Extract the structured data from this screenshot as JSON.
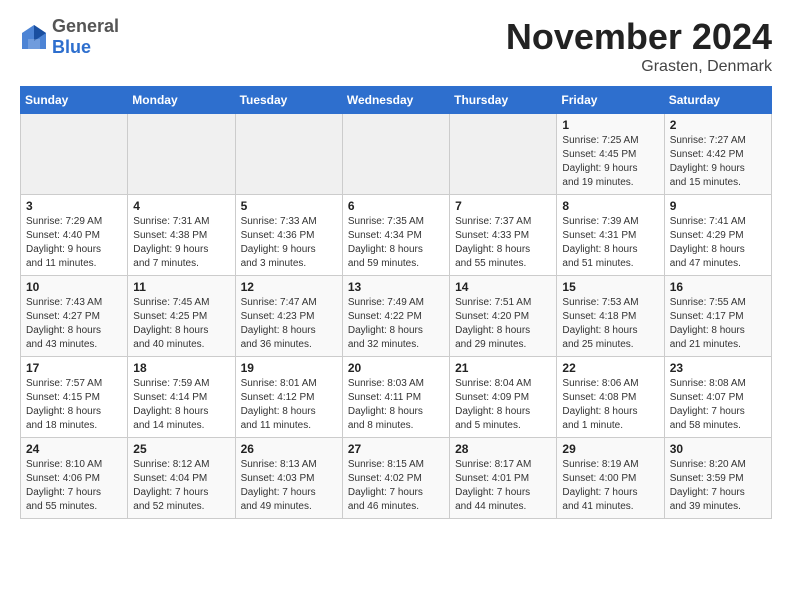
{
  "header": {
    "logo_general": "General",
    "logo_blue": "Blue",
    "title": "November 2024",
    "location": "Grasten, Denmark"
  },
  "weekdays": [
    "Sunday",
    "Monday",
    "Tuesday",
    "Wednesday",
    "Thursday",
    "Friday",
    "Saturday"
  ],
  "weeks": [
    [
      {
        "day": "",
        "info": ""
      },
      {
        "day": "",
        "info": ""
      },
      {
        "day": "",
        "info": ""
      },
      {
        "day": "",
        "info": ""
      },
      {
        "day": "",
        "info": ""
      },
      {
        "day": "1",
        "info": "Sunrise: 7:25 AM\nSunset: 4:45 PM\nDaylight: 9 hours\nand 19 minutes."
      },
      {
        "day": "2",
        "info": "Sunrise: 7:27 AM\nSunset: 4:42 PM\nDaylight: 9 hours\nand 15 minutes."
      }
    ],
    [
      {
        "day": "3",
        "info": "Sunrise: 7:29 AM\nSunset: 4:40 PM\nDaylight: 9 hours\nand 11 minutes."
      },
      {
        "day": "4",
        "info": "Sunrise: 7:31 AM\nSunset: 4:38 PM\nDaylight: 9 hours\nand 7 minutes."
      },
      {
        "day": "5",
        "info": "Sunrise: 7:33 AM\nSunset: 4:36 PM\nDaylight: 9 hours\nand 3 minutes."
      },
      {
        "day": "6",
        "info": "Sunrise: 7:35 AM\nSunset: 4:34 PM\nDaylight: 8 hours\nand 59 minutes."
      },
      {
        "day": "7",
        "info": "Sunrise: 7:37 AM\nSunset: 4:33 PM\nDaylight: 8 hours\nand 55 minutes."
      },
      {
        "day": "8",
        "info": "Sunrise: 7:39 AM\nSunset: 4:31 PM\nDaylight: 8 hours\nand 51 minutes."
      },
      {
        "day": "9",
        "info": "Sunrise: 7:41 AM\nSunset: 4:29 PM\nDaylight: 8 hours\nand 47 minutes."
      }
    ],
    [
      {
        "day": "10",
        "info": "Sunrise: 7:43 AM\nSunset: 4:27 PM\nDaylight: 8 hours\nand 43 minutes."
      },
      {
        "day": "11",
        "info": "Sunrise: 7:45 AM\nSunset: 4:25 PM\nDaylight: 8 hours\nand 40 minutes."
      },
      {
        "day": "12",
        "info": "Sunrise: 7:47 AM\nSunset: 4:23 PM\nDaylight: 8 hours\nand 36 minutes."
      },
      {
        "day": "13",
        "info": "Sunrise: 7:49 AM\nSunset: 4:22 PM\nDaylight: 8 hours\nand 32 minutes."
      },
      {
        "day": "14",
        "info": "Sunrise: 7:51 AM\nSunset: 4:20 PM\nDaylight: 8 hours\nand 29 minutes."
      },
      {
        "day": "15",
        "info": "Sunrise: 7:53 AM\nSunset: 4:18 PM\nDaylight: 8 hours\nand 25 minutes."
      },
      {
        "day": "16",
        "info": "Sunrise: 7:55 AM\nSunset: 4:17 PM\nDaylight: 8 hours\nand 21 minutes."
      }
    ],
    [
      {
        "day": "17",
        "info": "Sunrise: 7:57 AM\nSunset: 4:15 PM\nDaylight: 8 hours\nand 18 minutes."
      },
      {
        "day": "18",
        "info": "Sunrise: 7:59 AM\nSunset: 4:14 PM\nDaylight: 8 hours\nand 14 minutes."
      },
      {
        "day": "19",
        "info": "Sunrise: 8:01 AM\nSunset: 4:12 PM\nDaylight: 8 hours\nand 11 minutes."
      },
      {
        "day": "20",
        "info": "Sunrise: 8:03 AM\nSunset: 4:11 PM\nDaylight: 8 hours\nand 8 minutes."
      },
      {
        "day": "21",
        "info": "Sunrise: 8:04 AM\nSunset: 4:09 PM\nDaylight: 8 hours\nand 5 minutes."
      },
      {
        "day": "22",
        "info": "Sunrise: 8:06 AM\nSunset: 4:08 PM\nDaylight: 8 hours\nand 1 minute."
      },
      {
        "day": "23",
        "info": "Sunrise: 8:08 AM\nSunset: 4:07 PM\nDaylight: 7 hours\nand 58 minutes."
      }
    ],
    [
      {
        "day": "24",
        "info": "Sunrise: 8:10 AM\nSunset: 4:06 PM\nDaylight: 7 hours\nand 55 minutes."
      },
      {
        "day": "25",
        "info": "Sunrise: 8:12 AM\nSunset: 4:04 PM\nDaylight: 7 hours\nand 52 minutes."
      },
      {
        "day": "26",
        "info": "Sunrise: 8:13 AM\nSunset: 4:03 PM\nDaylight: 7 hours\nand 49 minutes."
      },
      {
        "day": "27",
        "info": "Sunrise: 8:15 AM\nSunset: 4:02 PM\nDaylight: 7 hours\nand 46 minutes."
      },
      {
        "day": "28",
        "info": "Sunrise: 8:17 AM\nSunset: 4:01 PM\nDaylight: 7 hours\nand 44 minutes."
      },
      {
        "day": "29",
        "info": "Sunrise: 8:19 AM\nSunset: 4:00 PM\nDaylight: 7 hours\nand 41 minutes."
      },
      {
        "day": "30",
        "info": "Sunrise: 8:20 AM\nSunset: 3:59 PM\nDaylight: 7 hours\nand 39 minutes."
      }
    ]
  ]
}
